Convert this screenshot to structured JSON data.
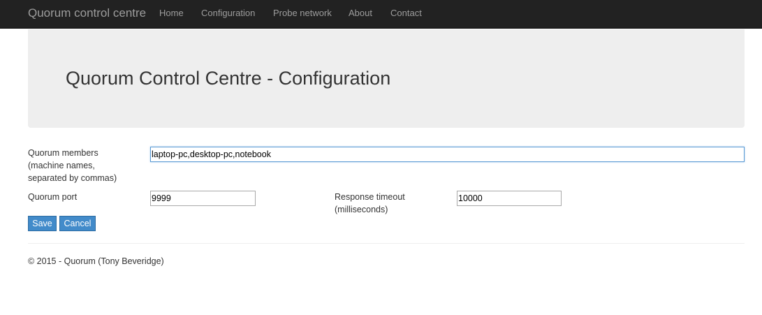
{
  "navbar": {
    "brand": "Quorum control centre",
    "links": [
      {
        "label": "Home"
      },
      {
        "label": "Configuration"
      },
      {
        "label": "Probe network"
      },
      {
        "label": "About"
      },
      {
        "label": "Contact"
      }
    ]
  },
  "jumbotron": {
    "title": "Quorum Control Centre - Configuration"
  },
  "form": {
    "members_label_line1": "Quorum members",
    "members_label_line2": "(machine names,",
    "members_label_line3": "separated by commas)",
    "members_value": "laptop-pc,desktop-pc,notebook",
    "port_label": "Quorum port",
    "port_value": "9999",
    "timeout_label_line1": "Response timeout",
    "timeout_label_line2": "(milliseconds)",
    "timeout_value": "10000",
    "save_label": "Save",
    "cancel_label": "Cancel"
  },
  "footer": {
    "text": "© 2015 - Quorum (Tony Beveridge)"
  },
  "colors": {
    "navbar_bg": "#222222",
    "nav_text": "#9d9d9d",
    "jumbotron_bg": "#eeeeee",
    "button_bg": "#428bca",
    "focus_border": "#5b9bd5"
  }
}
